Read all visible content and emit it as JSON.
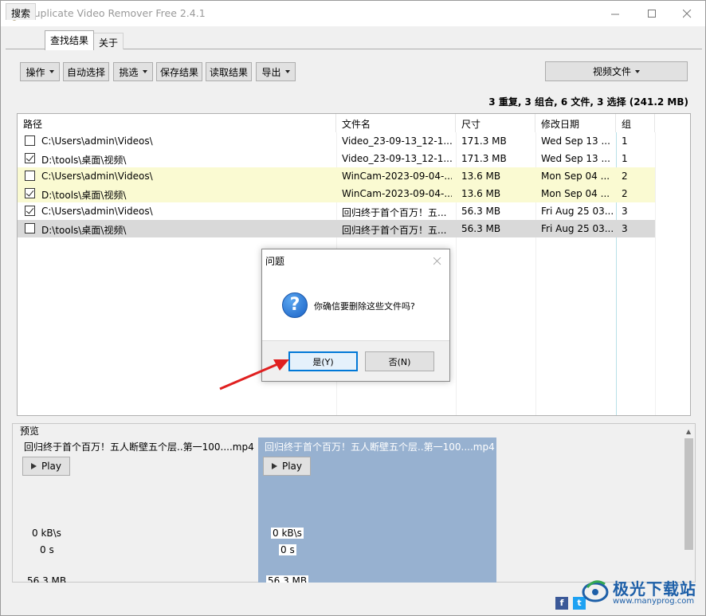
{
  "window": {
    "title": "Duplicate Video Remover Free 2.4.1"
  },
  "tabs": [
    {
      "label": "搜索"
    },
    {
      "label": "查找结果"
    },
    {
      "label": "关于"
    }
  ],
  "toolbar": {
    "actions_label": "操作",
    "auto_select_label": "自动选择",
    "filter_label": "挑选",
    "save_results_label": "保存结果",
    "load_results_label": "读取结果",
    "export_label": "导出",
    "video_files_label": "视频文件"
  },
  "summary": "3 重复, 3 组合, 6 文件, 3 选择 (241.2 MB)",
  "table": {
    "columns": [
      "路径",
      "文件名",
      "尺寸",
      "修改日期",
      "组"
    ],
    "rows": [
      {
        "checked": false,
        "path": "C:\\Users\\admin\\Videos\\",
        "filename": "Video_23-09-13_12-1...",
        "size": "171.3 MB",
        "date": "Wed Sep 13 ...",
        "group": "1",
        "state": "normal"
      },
      {
        "checked": true,
        "path": "D:\\tools\\桌面\\视频\\",
        "filename": "Video_23-09-13_12-1...",
        "size": "171.3 MB",
        "date": "Wed Sep 13 ...",
        "group": "1",
        "state": "normal"
      },
      {
        "checked": false,
        "path": "C:\\Users\\admin\\Videos\\",
        "filename": "WinCam-2023-09-04-...",
        "size": "13.6 MB",
        "date": "Mon Sep 04 ...",
        "group": "2",
        "state": "highlight"
      },
      {
        "checked": true,
        "path": "D:\\tools\\桌面\\视频\\",
        "filename": "WinCam-2023-09-04-...",
        "size": "13.6 MB",
        "date": "Mon Sep 04 ...",
        "group": "2",
        "state": "highlight"
      },
      {
        "checked": true,
        "path": "C:\\Users\\admin\\Videos\\",
        "filename": "回归终于首个百万！五...",
        "size": "56.3 MB",
        "date": "Fri Aug 25 03...",
        "group": "3",
        "state": "normal"
      },
      {
        "checked": false,
        "path": "D:\\tools\\桌面\\视频\\",
        "filename": "回归终于首个百万！五...",
        "size": "56.3 MB",
        "date": "Fri Aug 25 03...",
        "group": "3",
        "state": "selected"
      }
    ]
  },
  "dialog": {
    "title": "问题",
    "message": "你确信要删除这些文件吗?",
    "yes_label": "是(Y)",
    "no_label": "否(N)"
  },
  "preview": {
    "label": "预览",
    "cards": [
      {
        "filename": "回归终于首个百万！五人断壁五个层..第一100....mp4",
        "play_label": "Play",
        "speed": "0 kB\\s",
        "time": "0 s",
        "size": "56.3 MB"
      },
      {
        "filename": "回归终于首个百万！五人断壁五个层..第一100....mp4",
        "play_label": "Play",
        "speed": "0 kB\\s",
        "time": "0 s",
        "size": "56.3 MB"
      }
    ]
  },
  "watermark": {
    "main": "极光下载站",
    "sub": "www.manyprog.com"
  },
  "colors": {
    "highlight_row": "#fafad2",
    "selected_row": "#d9d9d9",
    "preview_selected": "#97b1d0",
    "accent": "#0078d7"
  }
}
